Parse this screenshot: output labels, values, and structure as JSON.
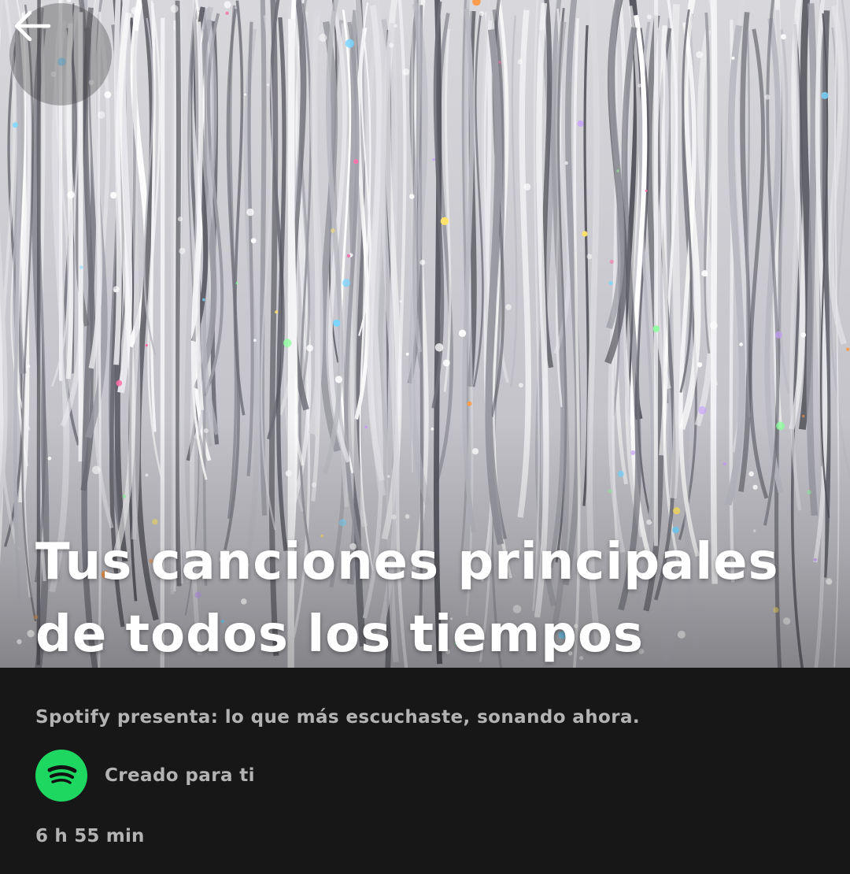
{
  "header": {
    "back_icon": "arrow-left-icon"
  },
  "playlist": {
    "title_line1": "Tus canciones principales",
    "title_line2": "de todos los tiempos",
    "description": "Spotify presenta: lo que más escuchaste, sonando ahora.",
    "creator_icon": "spotify-logo-icon",
    "creator": "Creado para ti",
    "duration": "6 h 55 min"
  },
  "colors": {
    "background": "#171717",
    "secondary_text": "#b3b3b3",
    "title_text": "#ffffff",
    "spotify_green": "#1ed760"
  }
}
